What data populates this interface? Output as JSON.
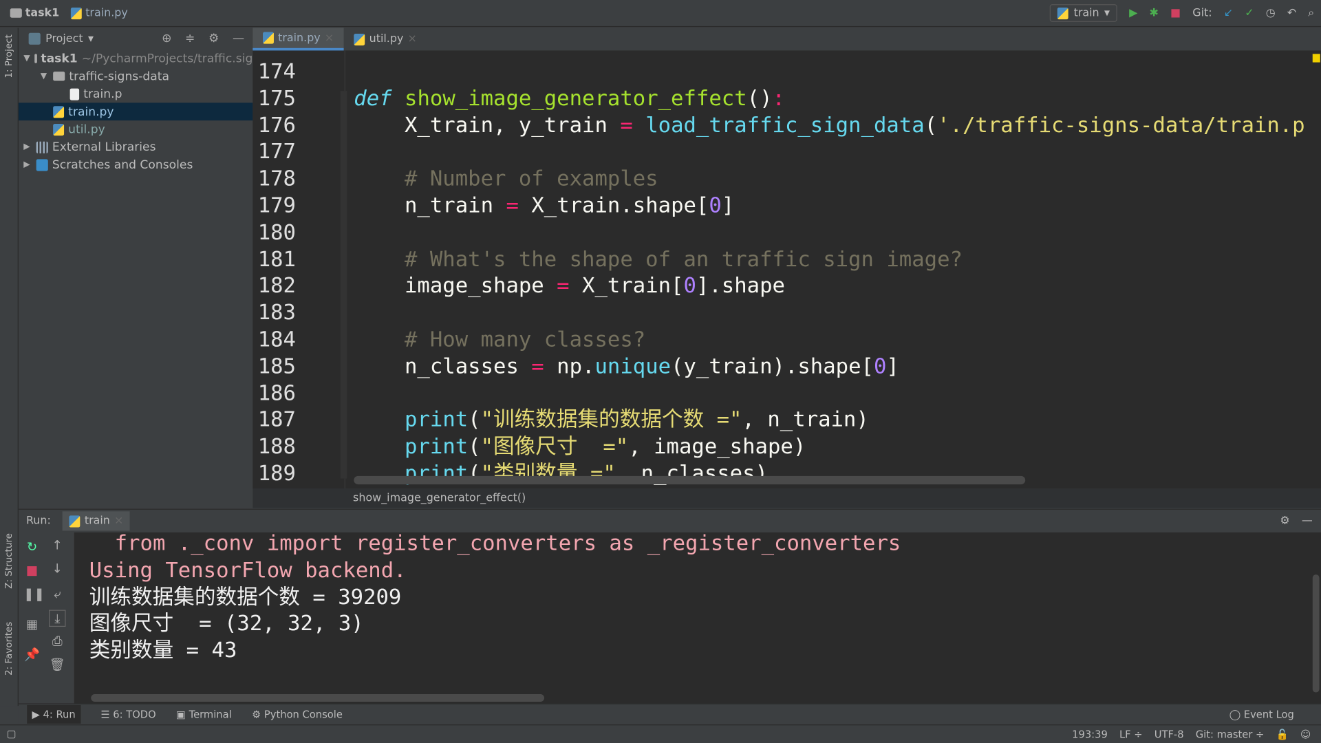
{
  "titlebar": {
    "project": "task1",
    "file": "train.py",
    "run_config": "train",
    "git_label": "Git:"
  },
  "left_strip": {
    "project": "1: Project",
    "structure": "Z: Structure",
    "favorites": "2: Favorites"
  },
  "project_panel": {
    "title": "Project",
    "items": [
      {
        "label": "task1",
        "extra": "~/PycharmProjects/traffic.sig",
        "depth": 0,
        "type": "folder",
        "expanded": true
      },
      {
        "label": "traffic-signs-data",
        "depth": 1,
        "type": "folder",
        "expanded": true
      },
      {
        "label": "train.p",
        "depth": 2,
        "type": "file"
      },
      {
        "label": "train.py",
        "depth": 1,
        "type": "py",
        "selected": true
      },
      {
        "label": "util.py",
        "depth": 1,
        "type": "py"
      },
      {
        "label": "External Libraries",
        "depth": 0,
        "type": "lib",
        "expanded": false
      },
      {
        "label": "Scratches and Consoles",
        "depth": 0,
        "type": "scratch",
        "expanded": false
      }
    ]
  },
  "editor_tabs": [
    {
      "label": "train.py",
      "active": true
    },
    {
      "label": "util.py",
      "active": false
    }
  ],
  "code": {
    "lines": [
      {
        "n": "174",
        "t": []
      },
      {
        "n": "175",
        "t": [
          [
            "kw",
            "def"
          ],
          [
            "pl",
            " "
          ],
          [
            "fn",
            "show_image_generator_effect"
          ],
          [
            "pl",
            "()"
          ],
          [
            "op",
            ":"
          ]
        ]
      },
      {
        "n": "176",
        "t": [
          [
            "pl",
            "    X_train, y_train "
          ],
          [
            "op",
            "="
          ],
          [
            "pl",
            " "
          ],
          [
            "bi",
            "load_traffic_sign_data"
          ],
          [
            "pl",
            "("
          ],
          [
            "str",
            "'./traffic-signs-data/train.p"
          ]
        ]
      },
      {
        "n": "177",
        "t": []
      },
      {
        "n": "178",
        "t": [
          [
            "cm",
            "    # Number of examples"
          ]
        ]
      },
      {
        "n": "179",
        "t": [
          [
            "pl",
            "    n_train "
          ],
          [
            "op",
            "="
          ],
          [
            "pl",
            " X_train.shape["
          ],
          [
            "num",
            "0"
          ],
          [
            "pl",
            "]"
          ]
        ]
      },
      {
        "n": "180",
        "t": []
      },
      {
        "n": "181",
        "t": [
          [
            "cm",
            "    # What's the shape of an traffic sign image?"
          ]
        ]
      },
      {
        "n": "182",
        "t": [
          [
            "pl",
            "    image_shape "
          ],
          [
            "op",
            "="
          ],
          [
            "pl",
            " X_train["
          ],
          [
            "num",
            "0"
          ],
          [
            "pl",
            "].shape"
          ]
        ]
      },
      {
        "n": "183",
        "t": []
      },
      {
        "n": "184",
        "t": [
          [
            "cm",
            "    # How many classes?"
          ]
        ]
      },
      {
        "n": "185",
        "t": [
          [
            "pl",
            "    n_classes "
          ],
          [
            "op",
            "="
          ],
          [
            "pl",
            " np."
          ],
          [
            "bi",
            "unique"
          ],
          [
            "pl",
            "(y_train).shape["
          ],
          [
            "num",
            "0"
          ],
          [
            "pl",
            "]"
          ]
        ]
      },
      {
        "n": "186",
        "t": []
      },
      {
        "n": "187",
        "t": [
          [
            "pl",
            "    "
          ],
          [
            "bi",
            "print"
          ],
          [
            "pl",
            "("
          ],
          [
            "str",
            "\"训练数据集的数据个数 =\""
          ],
          [
            "pl",
            ", n_train)"
          ]
        ]
      },
      {
        "n": "188",
        "t": [
          [
            "pl",
            "    "
          ],
          [
            "bi",
            "print"
          ],
          [
            "pl",
            "("
          ],
          [
            "str",
            "\"图像尺寸  =\""
          ],
          [
            "pl",
            ", image_shape)"
          ]
        ]
      },
      {
        "n": "189",
        "t": [
          [
            "pl",
            "    "
          ],
          [
            "bi",
            "print"
          ],
          [
            "pl",
            "("
          ],
          [
            "str",
            "\"类别数量 =\""
          ],
          [
            "pl",
            ", n_classes)"
          ]
        ]
      }
    ]
  },
  "breadcrumb": "show_image_generator_effect()",
  "run": {
    "label": "Run:",
    "tab": "train"
  },
  "console": [
    {
      "cls": "err",
      "text": "  from ._conv import register_converters as _register_converters"
    },
    {
      "cls": "err",
      "text": "Using TensorFlow backend."
    },
    {
      "cls": "out",
      "text": "训练数据集的数据个数 = 39209"
    },
    {
      "cls": "out",
      "text": "图像尺寸  = (32, 32, 3)"
    },
    {
      "cls": "out",
      "text": "类别数量 = 43"
    }
  ],
  "toolwindows": {
    "run": "4: Run",
    "todo": "6: TODO",
    "terminal": "Terminal",
    "python_console": "Python Console",
    "event_log": "Event Log"
  },
  "status": {
    "position": "193:39",
    "line_sep": "LF ÷",
    "encoding": "UTF-8",
    "git": "Git: master ÷"
  }
}
